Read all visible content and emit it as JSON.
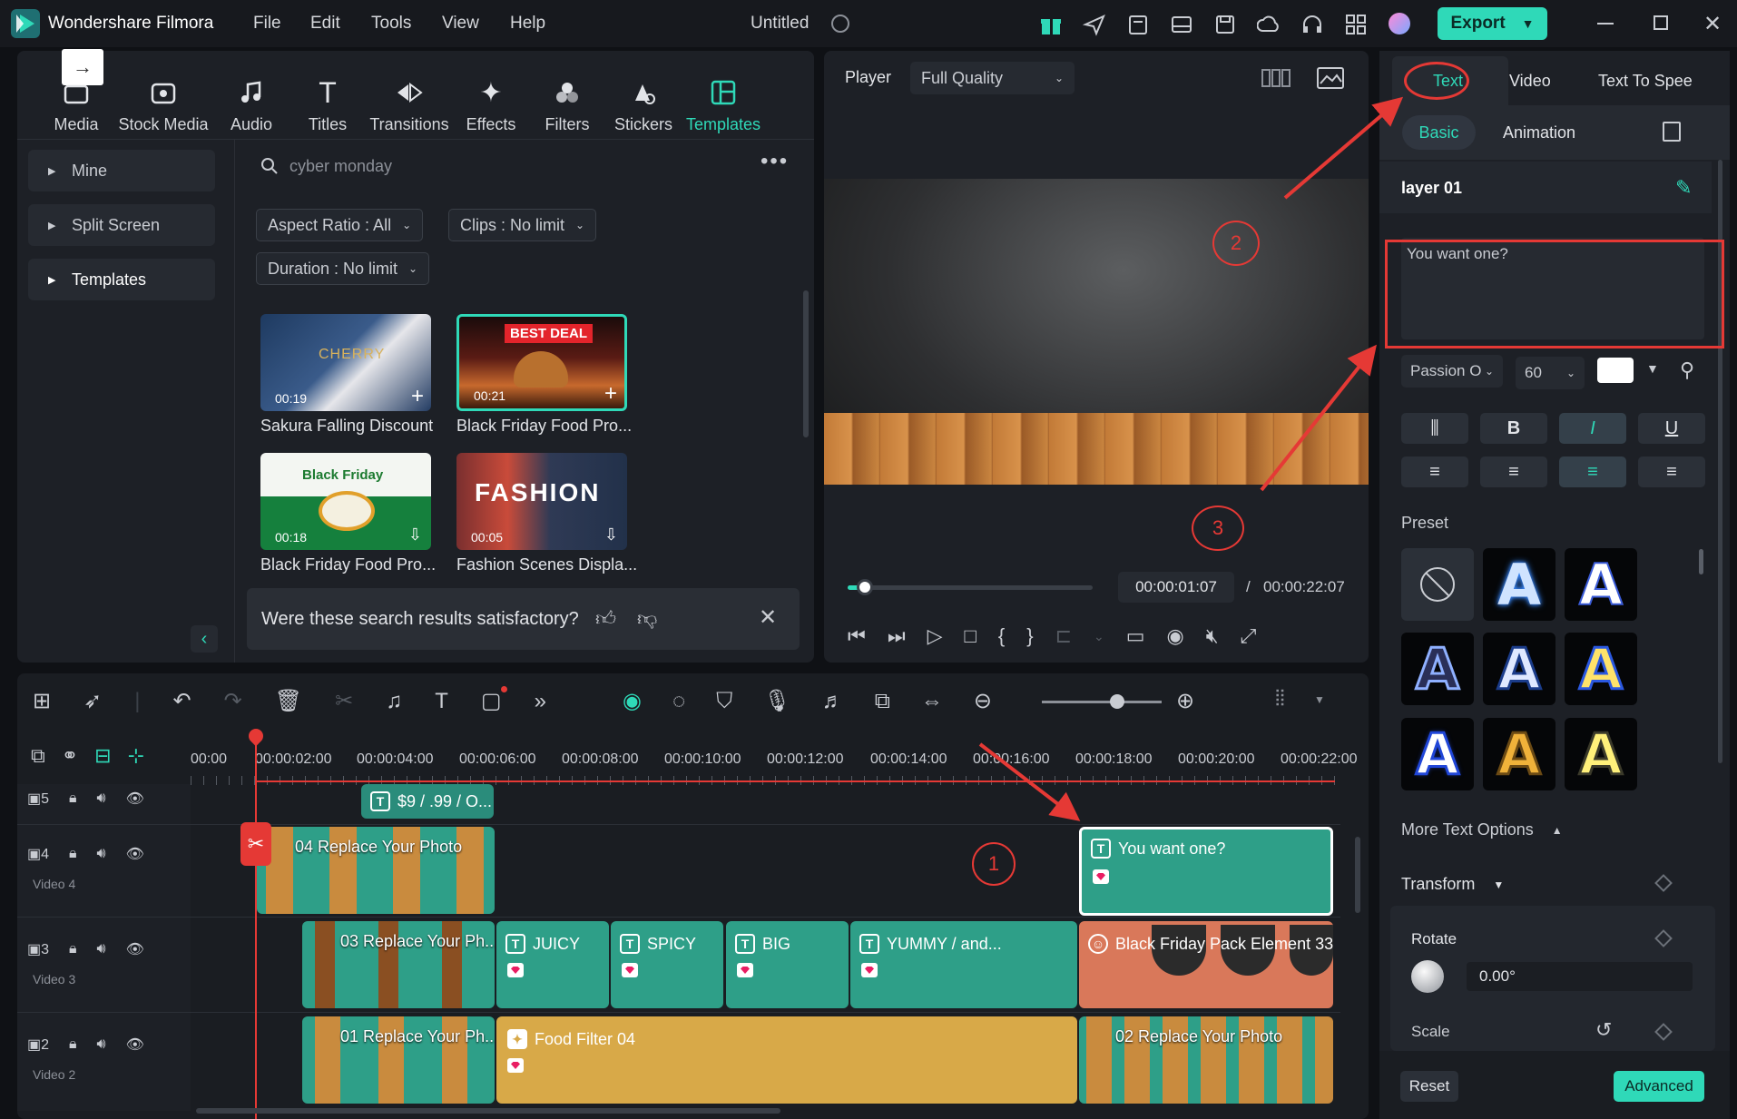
{
  "app": {
    "name": "Wondershare Filmora",
    "doc_title": "Untitled",
    "export_label": "Export"
  },
  "menu": [
    "File",
    "Edit",
    "Tools",
    "View",
    "Help"
  ],
  "toolbar": [
    "Media",
    "Stock Media",
    "Audio",
    "Titles",
    "Transitions",
    "Effects",
    "Filters",
    "Stickers",
    "Templates"
  ],
  "sidebar": [
    "Mine",
    "Split Screen",
    "Templates"
  ],
  "search": {
    "value": "cyber monday"
  },
  "filters": {
    "aspect": "Aspect Ratio : All",
    "clips": "Clips : No limit",
    "duration": "Duration : No limit"
  },
  "templates": [
    {
      "title": "Sakura Falling Discount",
      "duration": "00:19",
      "thumb_text": "CHERRY"
    },
    {
      "title": "Black Friday Food Pro...",
      "duration": "00:21",
      "thumb_text": "BEST DEAL"
    },
    {
      "title": "Black Friday Food Pro...",
      "duration": "00:18",
      "thumb_text": "Black Friday"
    },
    {
      "title": "Fashion Scenes Displa...",
      "duration": "00:05",
      "thumb_text": "FASHION"
    }
  ],
  "feedback": {
    "question": "Were these search results satisfactory?"
  },
  "player": {
    "label": "Player",
    "quality": "Full Quality",
    "current": "00:00:01:07",
    "sep": "/",
    "total": "00:00:22:07",
    "progress": 0.07
  },
  "right": {
    "tabs": [
      "Text",
      "Video",
      "Text To Spee"
    ],
    "subtabs": [
      "Basic",
      "Animation"
    ],
    "layer": "layer 01",
    "text_value": "You want one?",
    "font": "Passion O",
    "size": "60",
    "format_buttons": [
      "B",
      "I",
      "U"
    ],
    "preset_label": "Preset",
    "more_label": "More Text Options",
    "transform_label": "Transform",
    "rotate_label": "Rotate",
    "rotate_value": "0.00°",
    "scale_label": "Scale",
    "reset": "Reset",
    "advanced": "Advanced"
  },
  "timeline": {
    "ticks": [
      "00:00",
      "00:00:02:00",
      "00:00:04:00",
      "00:00:06:00",
      "00:00:08:00",
      "00:00:10:00",
      "00:00:12:00",
      "00:00:14:00",
      "00:00:16:00",
      "00:00:18:00",
      "00:00:20:00",
      "00:00:22:00"
    ],
    "zoom": 0.5,
    "tracks": [
      {
        "num": "5",
        "label": ""
      },
      {
        "num": "4",
        "label": "Video 4"
      },
      {
        "num": "3",
        "label": "Video 3"
      },
      {
        "num": "2",
        "label": "Video 2"
      }
    ],
    "clips": {
      "t5_title": "$9 / .99 / O...",
      "t4_video": "04 Replace Your Photo",
      "t4_text": "You want one?",
      "t3_video": "03 Replace Your Ph...",
      "t3_juicy": "JUICY",
      "t3_spicy": "SPICY",
      "t3_big": "BIG",
      "t3_yummy": "YUMMY / and...",
      "t3_pack": "Black Friday Pack Element 33",
      "t2_video": "01 Replace Your Ph...",
      "t2_filter": "Food Filter 04",
      "t2_video2": "02 Replace Your Photo"
    }
  },
  "annotations": [
    "1",
    "2",
    "3"
  ],
  "colors": {
    "accent": "#2fd9b8",
    "annotation": "#e53935",
    "clip_teal": "#2e9f88",
    "clip_orange": "#d9785a",
    "clip_gold": "#d8a948",
    "clip_text": "#2a8c7b"
  }
}
